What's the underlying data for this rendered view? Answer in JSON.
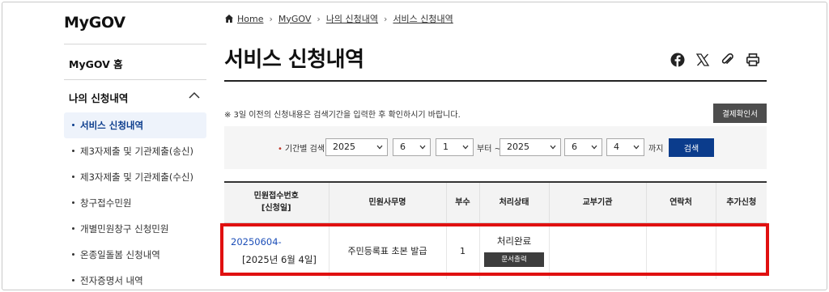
{
  "sidebar": {
    "logo": "MyGOV",
    "home": "MyGOV 홈",
    "section_title": "나의 신청내역",
    "items": [
      {
        "label": "서비스 신청내역",
        "active": true
      },
      {
        "label": "제3자제출 및 기관제출(송신)",
        "active": false
      },
      {
        "label": "제3자제출 및 기관제출(수신)",
        "active": false
      },
      {
        "label": "창구접수민원",
        "active": false
      },
      {
        "label": "개별민원창구 신청민원",
        "active": false
      },
      {
        "label": "온종일돌봄 신청내역",
        "active": false
      },
      {
        "label": "전자증명서 내역",
        "active": false
      }
    ]
  },
  "breadcrumb": [
    "Home",
    "MyGOV",
    "나의 신청내역",
    "서비스 신청내역"
  ],
  "page_title": "서비스 신청내역",
  "share_icons": [
    "facebook-icon",
    "x-icon",
    "link-icon",
    "print-icon"
  ],
  "notice": "※ 3일 이전의 신청내용은 검색기간을 입력한 후 확인하시기 바랍니다.",
  "receipt_button": "결제확인서",
  "search": {
    "label": "기간별 검색",
    "from_year": "2025",
    "from_month": "6",
    "from_day": "1",
    "from_suffix": "부터 ~",
    "to_year": "2025",
    "to_month": "6",
    "to_day": "4",
    "to_suffix": "까지",
    "button": "검색"
  },
  "table": {
    "headers": {
      "receipt_no": "민원접수번호",
      "apply_date": "[신청일]",
      "service": "민원사무명",
      "copies": "부수",
      "status": "처리상태",
      "agency": "교부기관",
      "contact": "연락처",
      "extra": "추가신청"
    },
    "rows": [
      {
        "receipt_no": "20250604-",
        "apply_date": "[2025년 6월 4일]",
        "service": "주민등록표 초본 발급",
        "copies": "1",
        "status": "처리완료",
        "doc_button": "문서출력",
        "agency": "",
        "contact": "",
        "extra": ""
      }
    ]
  },
  "colors": {
    "accent": "#0b3c8c",
    "highlight": "#e01010",
    "link": "#1d4fb8"
  }
}
